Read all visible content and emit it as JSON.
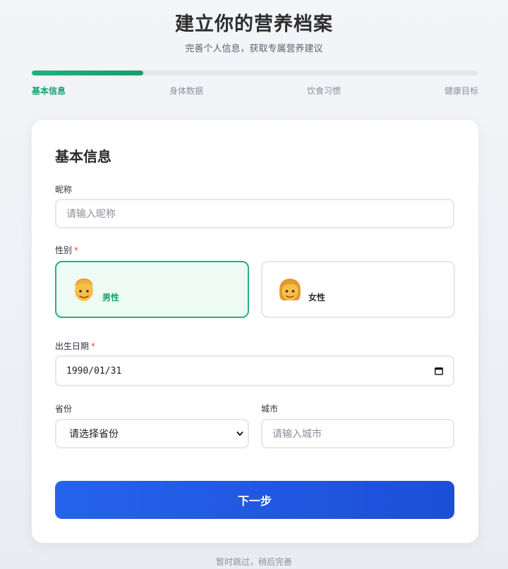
{
  "header": {
    "title": "建立你的营养档案",
    "subtitle": "完善个人信息，获取专属营养建议"
  },
  "progress": {
    "fraction": 0.25,
    "steps": [
      {
        "label": "基本信息",
        "active": true
      },
      {
        "label": "身体数据",
        "active": false
      },
      {
        "label": "饮食习惯",
        "active": false
      },
      {
        "label": "健康目标",
        "active": false
      }
    ]
  },
  "form": {
    "section_title": "基本信息",
    "nickname": {
      "label": "昵称",
      "placeholder": "请输入昵称",
      "value": ""
    },
    "gender": {
      "label": "性别",
      "required_mark": "*",
      "options": [
        {
          "label": "男性",
          "icon": "man-emoji-icon",
          "selected": true
        },
        {
          "label": "女性",
          "icon": "woman-emoji-icon",
          "selected": false
        }
      ]
    },
    "birthdate": {
      "label": "出生日期",
      "required_mark": "*",
      "value": "1990/01/31"
    },
    "province": {
      "label": "省份",
      "selected": "请选择省份"
    },
    "city": {
      "label": "城市",
      "placeholder": "请输入城市",
      "value": ""
    },
    "next_label": "下一步"
  },
  "footer": {
    "skip_label": "暂时跳过，稍后完善"
  },
  "colors": {
    "accent_green": "#16a06d",
    "primary_blue": "#2563eb",
    "required_red": "#e5484d"
  }
}
